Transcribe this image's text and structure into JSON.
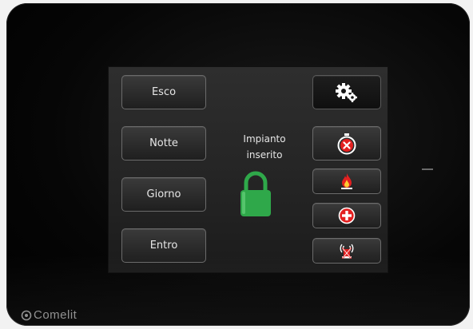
{
  "panel": {
    "mode_buttons": [
      {
        "label": "Esco"
      },
      {
        "label": "Notte"
      },
      {
        "label": "Giorno"
      },
      {
        "label": "Entro"
      }
    ],
    "status_line1": "Impianto",
    "status_line2": "inserito",
    "lock_icon": "padlock-closed-icon",
    "lock_color": "#2fa84a",
    "action_buttons": [
      {
        "icon": "gears-icon",
        "active": true
      },
      {
        "icon": "timer-cancel-icon"
      },
      {
        "icon": "fire-alarm-icon"
      },
      {
        "icon": "medical-cross-icon"
      },
      {
        "icon": "siren-cancel-icon"
      }
    ],
    "alert_color": "#e32020"
  },
  "brand": {
    "name": "Comelit",
    "logo_icon": "comelit-logo-icon"
  }
}
